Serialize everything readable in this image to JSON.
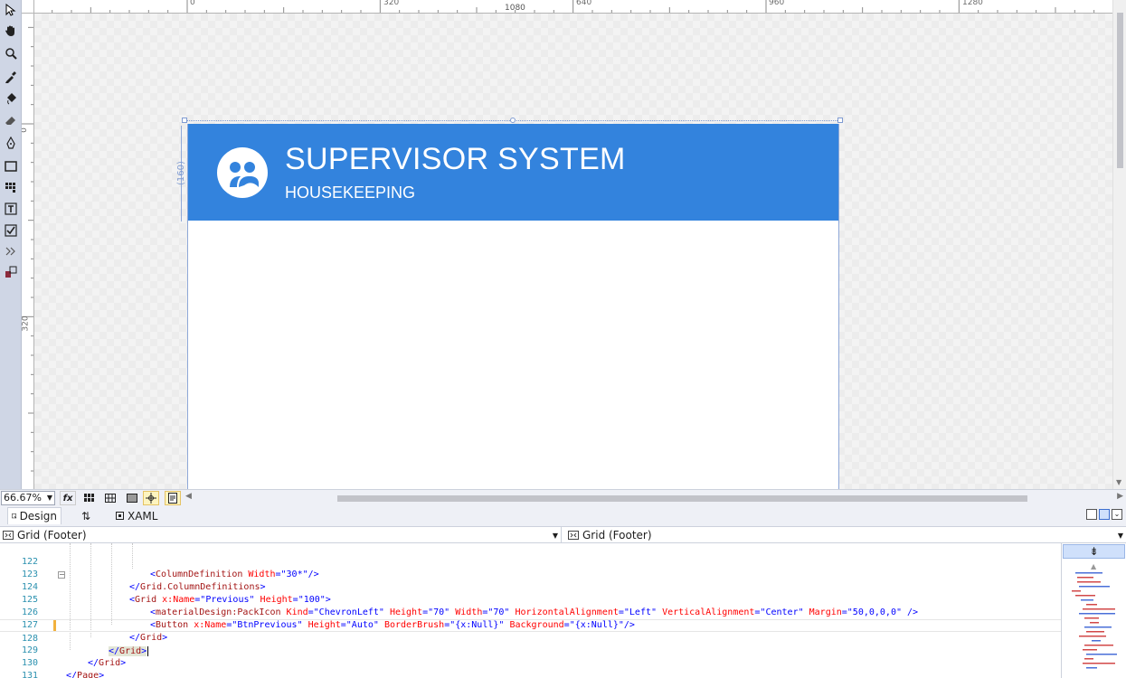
{
  "zoom": {
    "value": "66.67%"
  },
  "tabs": {
    "design": "Design",
    "swap": "⇅",
    "xaml": "XAML"
  },
  "breadcrumb": {
    "left": "Grid (Footer)",
    "right": "Grid (Footer)"
  },
  "ruler": {
    "top_marks": [
      "0",
      "320",
      "640",
      "960",
      "1280"
    ],
    "width_label": "1080",
    "left_marks": [
      "0",
      "320"
    ],
    "height_label": "(160)"
  },
  "page": {
    "title": "SUPERVISOR SYSTEM",
    "subtitle": "HOUSEKEEPING"
  },
  "code": {
    "lines": [
      {
        "num": "122",
        "text": "<ColumnDefinition Width=\"30*\"/>"
      },
      {
        "num": "123",
        "text": "</Grid.ColumnDefinitions>"
      },
      {
        "num": "124",
        "text": "<Grid x:Name=\"Previous\" Height=\"100\">"
      },
      {
        "num": "125",
        "text": "<materialDesign:PackIcon Kind=\"ChevronLeft\" Height=\"70\" Width=\"70\" HorizontalAlignment=\"Left\" VerticalAlignment=\"Center\" Margin=\"50,0,0,0\" />"
      },
      {
        "num": "126",
        "text": "<Button x:Name=\"BtnPrevious\" Height=\"Auto\" BorderBrush=\"{x:Null}\" Background=\"{x:Null}\"/>"
      },
      {
        "num": "127",
        "text": "</Grid>"
      },
      {
        "num": "128",
        "text": "</Grid>"
      },
      {
        "num": "129",
        "text": "</Grid>"
      },
      {
        "num": "130",
        "text": "</Page>"
      },
      {
        "num": "131",
        "text": ""
      }
    ]
  },
  "colors": {
    "header": "#3383dd",
    "accent": "#7f9bd2"
  }
}
